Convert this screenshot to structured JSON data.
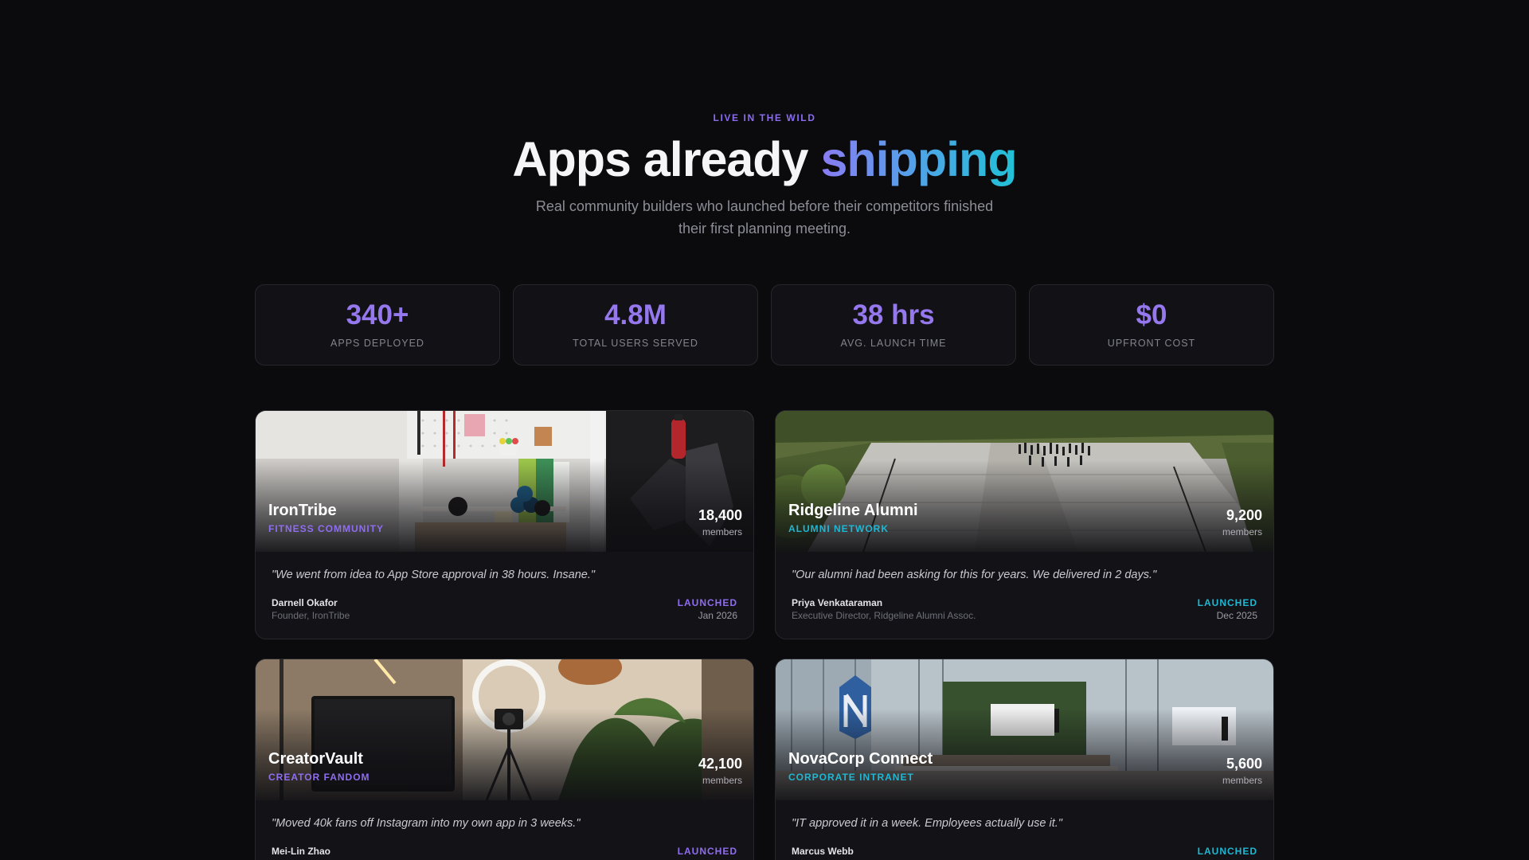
{
  "section": {
    "eyebrow": "LIVE IN THE WILD",
    "title_main": "Apps already",
    "title_accent": "shipping",
    "subtitle": "Real community builders who launched before their competitors finished their first planning meeting."
  },
  "stats": [
    {
      "value": "340+",
      "label": "APPS DEPLOYED"
    },
    {
      "value": "4.8M",
      "label": "TOTAL USERS SERVED"
    },
    {
      "value": "38 hrs",
      "label": "AVG. LAUNCH TIME"
    },
    {
      "value": "$0",
      "label": "UPFRONT COST"
    }
  ],
  "cards": [
    {
      "name": "IronTribe",
      "category": "FITNESS COMMUNITY",
      "members": "18,400",
      "members_label": "members",
      "quote": "\"We went from idea to App Store approval in 38 hours. Insane.\"",
      "person": "Darnell Okafor",
      "role": "Founder, IronTribe",
      "status": "LAUNCHED",
      "date": "Jan 2026",
      "accent_color": "#8f6df0"
    },
    {
      "name": "Ridgeline Alumni",
      "category": "ALUMNI NETWORK",
      "members": "9,200",
      "members_label": "members",
      "quote": "\"Our alumni had been asking for this for years. We delivered in 2 days.\"",
      "person": "Priya Venkataraman",
      "role": "Executive Director, Ridgeline Alumni Assoc.",
      "status": "LAUNCHED",
      "date": "Dec 2025",
      "accent_color": "#1fb7d3"
    },
    {
      "name": "CreatorVault",
      "category": "CREATOR FANDOM",
      "members": "42,100",
      "members_label": "members",
      "quote": "\"Moved 40k fans off Instagram into my own app in 3 weeks.\"",
      "person": "Mei-Lin Zhao",
      "role": "",
      "status": "LAUNCHED",
      "date": "",
      "accent_color": "#8f6df0"
    },
    {
      "name": "NovaCorp Connect",
      "category": "CORPORATE INTRANET",
      "members": "5,600",
      "members_label": "members",
      "quote": "\"IT approved it in a week. Employees actually use it.\"",
      "person": "Marcus Webb",
      "role": "",
      "status": "LAUNCHED",
      "date": "",
      "accent_color": "#1fb7d3"
    }
  ],
  "icons": {
    "brand_logo": "nova-logo-icon"
  }
}
